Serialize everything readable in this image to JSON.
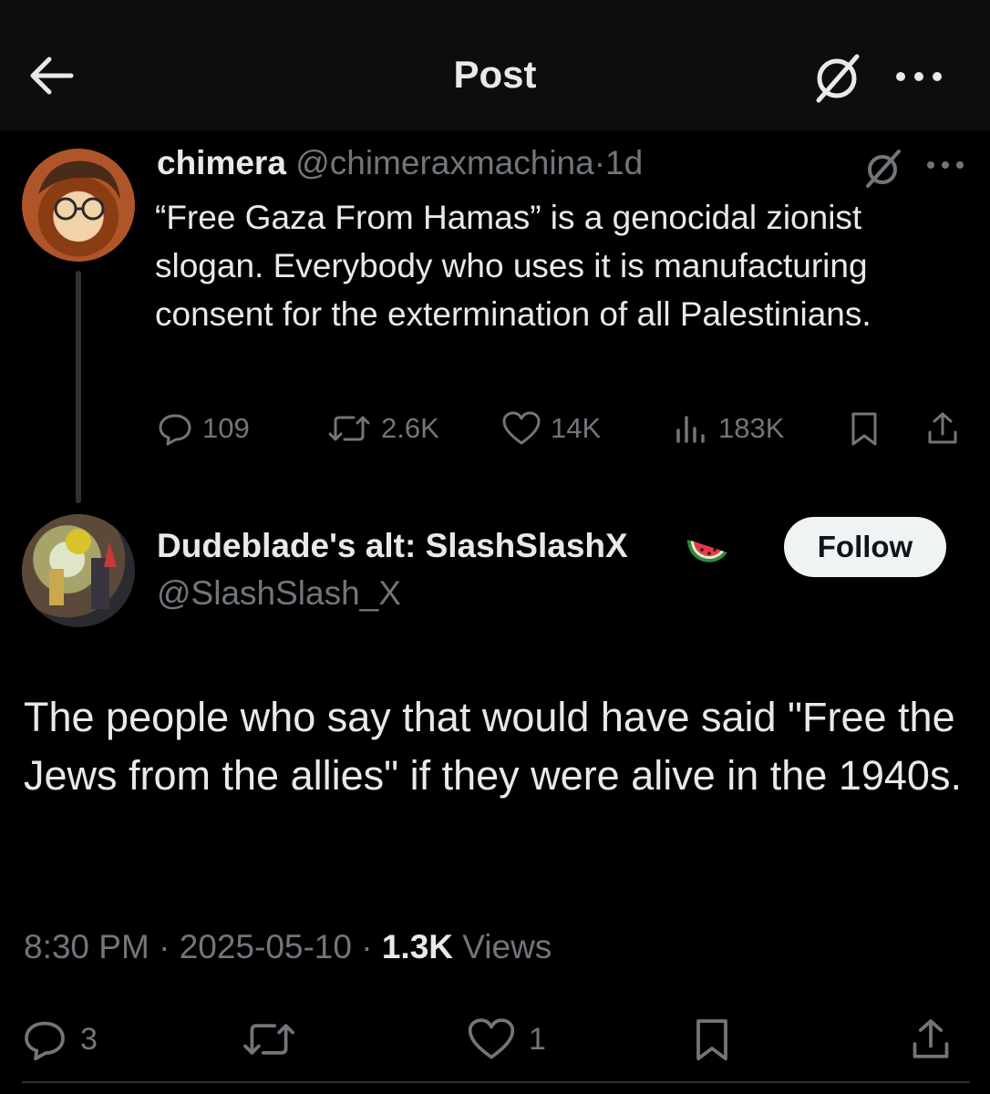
{
  "header": {
    "title": "Post"
  },
  "parent_post": {
    "display_name": "chimera",
    "handle": "@chimeraxmachina",
    "separator": "·",
    "age": "1d",
    "text": "“Free Gaza From Hamas” is a genocidal zionist slogan. Everybody who uses it is manufacturing consent for the extermination of all Palestinians.",
    "stats": {
      "replies": "109",
      "reposts": "2.6K",
      "likes": "14K",
      "views": "183K"
    }
  },
  "main_post": {
    "display_name": "Dudeblade's alt: SlashSlashX",
    "handle": "@SlashSlash_X",
    "follow_label": "Follow",
    "text": "The people who say that would have said \"Free the Jews from the allies\" if they were alive in the 1940s.",
    "time": "8:30 PM",
    "sep1": "·",
    "date": "2025-05-10",
    "sep2": "·",
    "views_count": "1.3K",
    "views_label": "Views",
    "stats": {
      "replies": "3",
      "likes": "1"
    }
  },
  "colors": {
    "background": "#000000",
    "header_bg": "#0d0d0d",
    "primary_text": "#e7e9ea",
    "secondary_text": "#71767b",
    "divider": "#2f3336",
    "follow_bg": "#eff3f4"
  }
}
